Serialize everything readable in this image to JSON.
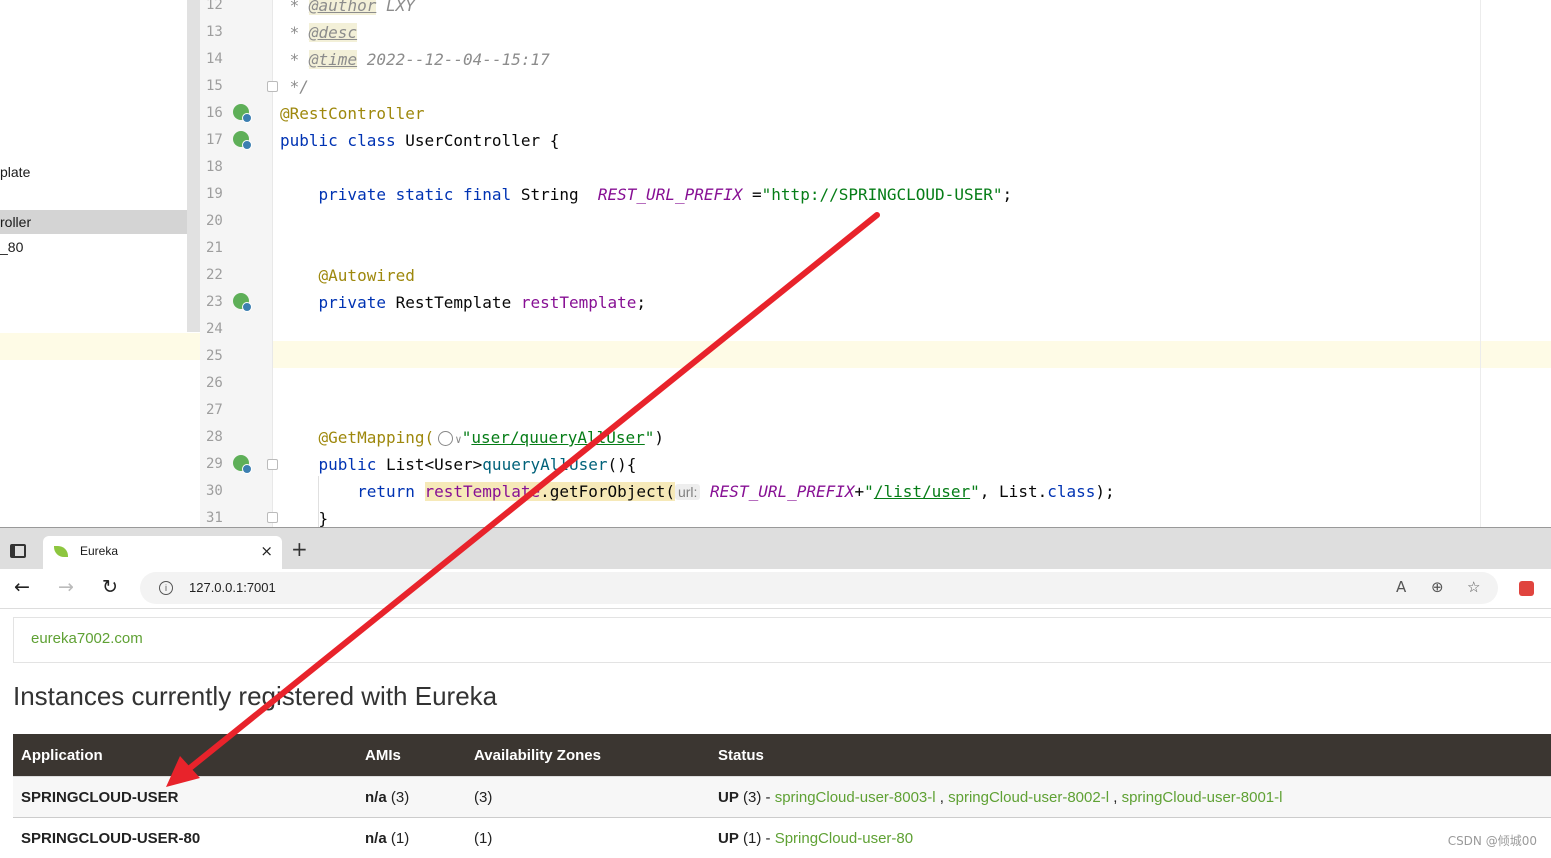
{
  "ide": {
    "tree_items": [
      "plate",
      "roller",
      "_80"
    ],
    "line_numbers": [
      "12",
      "13",
      "14",
      "15",
      "16",
      "17",
      "18",
      "19",
      "20",
      "21",
      "22",
      "23",
      "24",
      "25",
      "26",
      "27",
      "28",
      "29",
      "30",
      "31"
    ],
    "code": {
      "l12_star": " * ",
      "l12_tag": "@author",
      "l12_text": " LXY",
      "l13_star": " * ",
      "l13_tag": "@desc",
      "l14_star": " * ",
      "l14_tag": "@time",
      "l14_text": " 2022--12--04--15:17",
      "l15": " */",
      "l16": "@RestController",
      "l17_kw": "public class",
      "l17_rest": " UserController {",
      "l19_kw": "    private static final",
      "l19_type": " String  ",
      "l19_const": "REST_URL_PREFIX",
      "l19_eq": " =",
      "l19_str": "\"http://SPRINGCLOUD-USER\"",
      "l19_end": ";",
      "l22": "    @Autowired",
      "l23_kw": "    private",
      "l23_type": " RestTemplate ",
      "l23_field": "restTemplate",
      "l23_end": ";",
      "l28_ann": "    @GetMapping(",
      "l28_q1": "\"",
      "l28_path": "user/quueryAllUser",
      "l28_q2": "\"",
      "l28_end": ")",
      "l29_kw": "    public",
      "l29_type": " List<User>",
      "l29_method": "quueryAllUser",
      "l29_end": "(){",
      "l30_kw": "        return ",
      "l30_field": "restTemplate",
      "l30_call": ".getForObject(",
      "l30_hint": "url:",
      "l30_const": " REST_URL_PREFIX",
      "l30_plus": "+",
      "l30_q1": "\"",
      "l30_path": "/list/user",
      "l30_q2": "\"",
      "l30_end": ", List.",
      "l30_cls": "class",
      "l30_tail": ");",
      "l31": "    }"
    }
  },
  "browser": {
    "tab_title": "Eureka",
    "tab_close": "×",
    "new_tab": "+",
    "back": "←",
    "forward": "→",
    "reload": "↻",
    "url": "127.0.0.1:7001",
    "info_icon": "i",
    "read_aloud": "A",
    "zoom": "⊕",
    "favorite": "☆"
  },
  "eureka": {
    "replica": "eureka7002.com",
    "heading": "Instances currently registered with Eureka",
    "columns": [
      "Application",
      "AMIs",
      "Availability Zones",
      "Status"
    ],
    "rows": [
      {
        "application": "SPRINGCLOUD-USER",
        "ami_na": "n/a",
        "ami_count": " (3)",
        "zones": "(3)",
        "status_up": "UP",
        "status_count": " (3) - ",
        "instances": [
          "springCloud-user-8003-l",
          "springCloud-user-8002-l",
          "springCloud-user-8001-l"
        ]
      },
      {
        "application": "SPRINGCLOUD-USER-80",
        "ami_na": "n/a",
        "ami_count": " (1)",
        "zones": "(1)",
        "status_up": "UP",
        "status_count": " (1) - ",
        "instances": [
          "SpringCloud-user-80"
        ]
      }
    ]
  },
  "watermark": "CSDN @倾城00",
  "colors": {
    "arrow": "#e8232b",
    "eureka_green": "#5fa134",
    "table_header": "#3b3631"
  }
}
